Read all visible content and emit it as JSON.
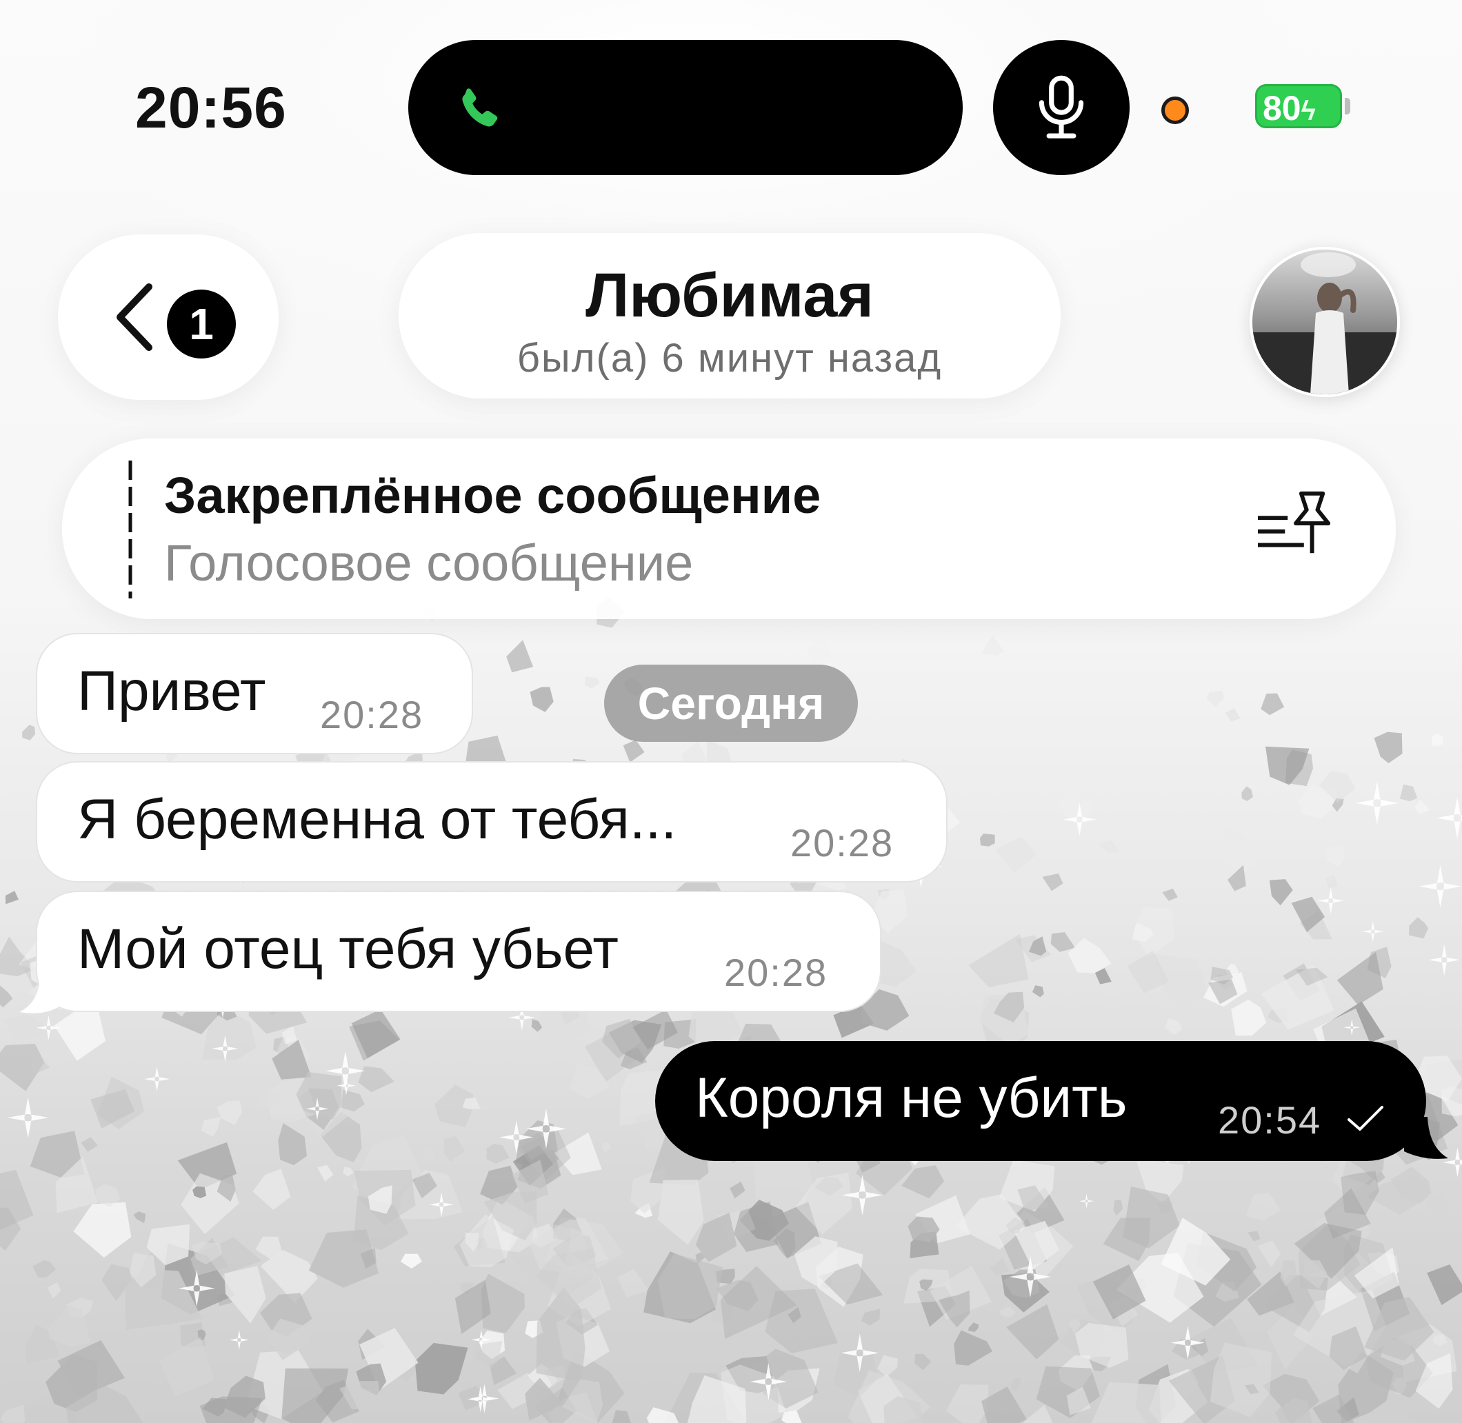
{
  "status_bar": {
    "time": "20:56",
    "battery_level": "80",
    "icons": [
      "phone-icon",
      "microphone-icon",
      "recording-dot-icon",
      "battery-charging-icon"
    ]
  },
  "header": {
    "back_badge_count": "1",
    "contact_name": "Любимая",
    "last_seen": "был(а) 6 минут назад",
    "icons": [
      "chevron-left-icon",
      "avatar-photo"
    ]
  },
  "pinned": {
    "title": "Закреплённое сообщение",
    "preview": "Голосовое сообщение",
    "icon": "pinned-list-icon"
  },
  "date_separator": "Сегодня",
  "messages": [
    {
      "direction": "in",
      "text": "Привет",
      "time": "20:28"
    },
    {
      "direction": "in",
      "text": "Я беременна от тебя...",
      "time": "20:28"
    },
    {
      "direction": "in",
      "text": "Мой отец тебя убьет",
      "time": "20:28"
    },
    {
      "direction": "out",
      "text": "Короля не убить",
      "time": "20:54",
      "status_icon": "single-check-icon"
    }
  ],
  "colors": {
    "outgoing_bubble": "#000000",
    "incoming_bubble": "#ffffff",
    "call_accent": "#34c759",
    "battery": "#2fcf52",
    "recording_dot": "#ff8a1c"
  }
}
